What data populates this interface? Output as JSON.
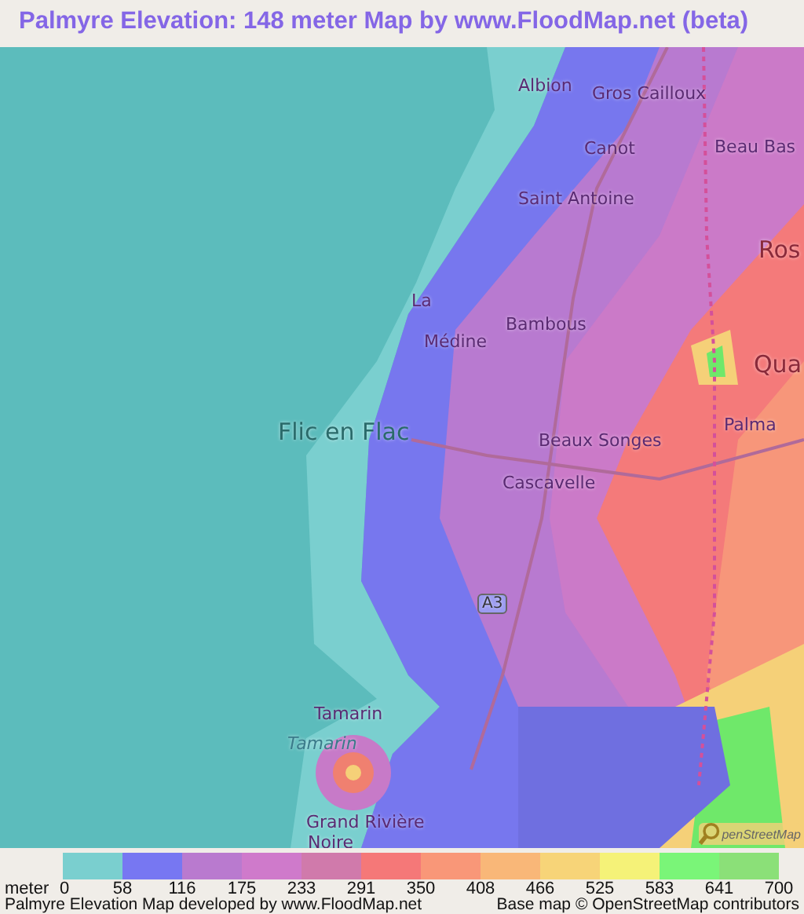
{
  "title": "Palmyre Elevation: 148 meter Map by www.FloodMap.net (beta)",
  "map": {
    "labels": [
      {
        "text": "Albion",
        "kind": "town"
      },
      {
        "text": "Gros Cailloux",
        "kind": "town"
      },
      {
        "text": "Canot",
        "kind": "town"
      },
      {
        "text": "Beau Bas",
        "kind": "town"
      },
      {
        "text": "Saint Antoine",
        "kind": "town"
      },
      {
        "text": "Ros",
        "kind": "city"
      },
      {
        "text": "La",
        "kind": "town"
      },
      {
        "text": "Bambous",
        "kind": "town"
      },
      {
        "text": "Médine",
        "kind": "town"
      },
      {
        "text": "Qua",
        "kind": "city"
      },
      {
        "text": "Palma",
        "kind": "town"
      },
      {
        "text": "Flic en Flac",
        "kind": "city"
      },
      {
        "text": "Beaux Songes",
        "kind": "town"
      },
      {
        "text": "Cascavelle",
        "kind": "town"
      },
      {
        "text": "A3",
        "kind": "road"
      },
      {
        "text": "Tamarin",
        "kind": "town"
      },
      {
        "text": "Tamarin",
        "kind": "water"
      },
      {
        "text": "Grand Rivière",
        "kind": "town"
      },
      {
        "text": "Noire",
        "kind": "town"
      }
    ],
    "osm_logo": "penStreetMap"
  },
  "legend": {
    "unit": "meter",
    "ticks": [
      "0",
      "58",
      "116",
      "175",
      "233",
      "291",
      "350",
      "408",
      "466",
      "525",
      "583",
      "641",
      "700"
    ],
    "swatches": [
      {
        "color": "#7acfcf"
      },
      {
        "color": "#7777f2"
      },
      {
        "color": "#b97acf"
      },
      {
        "color": "#cf7acb"
      },
      {
        "color": "#d07aab"
      },
      {
        "color": "#f57878"
      },
      {
        "color": "#f99778"
      },
      {
        "color": "#f9b778"
      },
      {
        "color": "#f7d478"
      },
      {
        "color": "#f5f278"
      },
      {
        "color": "#7af578"
      },
      {
        "color": "#8be078"
      }
    ]
  },
  "footer": {
    "left": "Palmyre Elevation Map developed by www.FloodMap.net",
    "right": "Base map © OpenStreetMap contributors"
  }
}
